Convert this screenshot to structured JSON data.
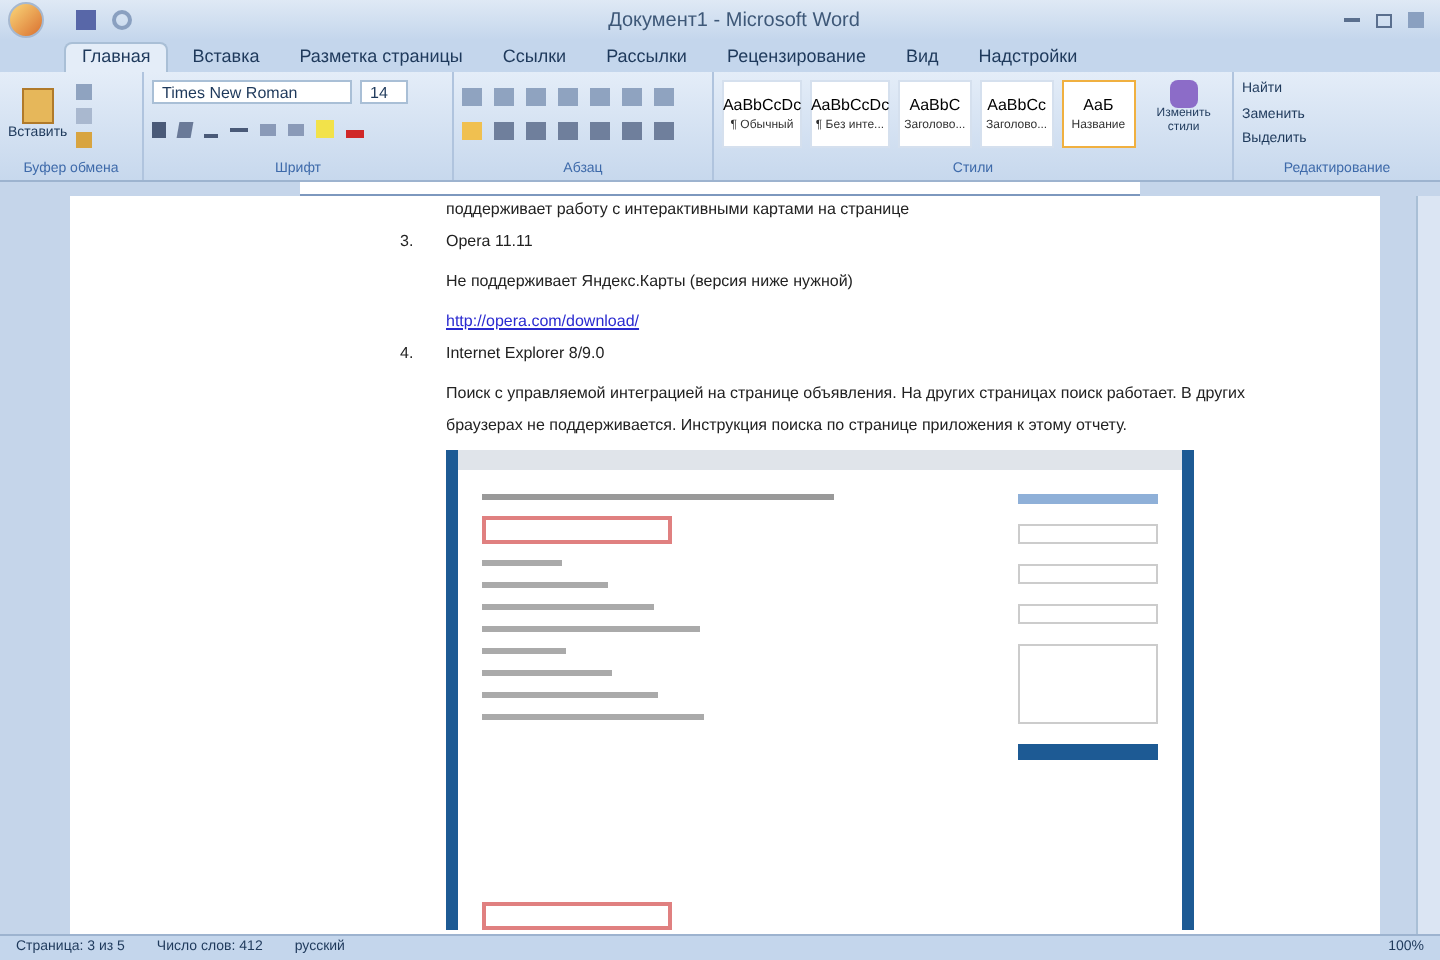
{
  "window": {
    "title": "Документ1 - Microsoft Word"
  },
  "tabs": [
    {
      "label": "Главная",
      "selected": true
    },
    {
      "label": "Вставка",
      "selected": false
    },
    {
      "label": "Разметка страницы",
      "selected": false
    },
    {
      "label": "Ссылки",
      "selected": false
    },
    {
      "label": "Рассылки",
      "selected": false
    },
    {
      "label": "Рецензирование",
      "selected": false
    },
    {
      "label": "Вид",
      "selected": false
    },
    {
      "label": "Надстройки",
      "selected": false
    }
  ],
  "ribbon": {
    "paste_label": "Вставить",
    "font_name": "Times New Roman",
    "font_size": "14",
    "styles": [
      {
        "sample": "AaBbCcDc",
        "label": "¶ Обычный",
        "selected": false
      },
      {
        "sample": "AaBbCcDc",
        "label": "¶ Без инте...",
        "selected": false
      },
      {
        "sample": "AaBbC",
        "label": "Заголово...",
        "selected": false
      },
      {
        "sample": "AaBbCc",
        "label": "Заголово...",
        "selected": false
      },
      {
        "sample": "АаБ",
        "label": "Название",
        "selected": true
      }
    ],
    "change_styles": "Изменить стили",
    "editing": [
      "Найти",
      "Заменить",
      "Выделить"
    ],
    "groups": [
      "Буфер обмена",
      "Шрифт",
      "Абзац",
      "Стили",
      "Редактирование"
    ]
  },
  "document": {
    "top_line": "поддерживает работу с интерактивными картами на странице",
    "items": [
      {
        "number": "3.",
        "title": "Opera 11.11",
        "text": "Не поддерживает Яндекс.Карты (версия ниже нужной)",
        "link": "http://opera.com/download/"
      },
      {
        "number": "4.",
        "title": "Internet Explorer 8/9.0",
        "text": "Поиск с управляемой интеграцией на странице объявления. На других страницах поиск работает. В других браузерах не поддерживается. Инструкция поиска по странице приложения к этому отчету."
      }
    ]
  },
  "status_bar": {
    "page": "Страница: 3 из 5",
    "words": "Число слов: 412",
    "language": "русский",
    "zoom": "100%"
  }
}
